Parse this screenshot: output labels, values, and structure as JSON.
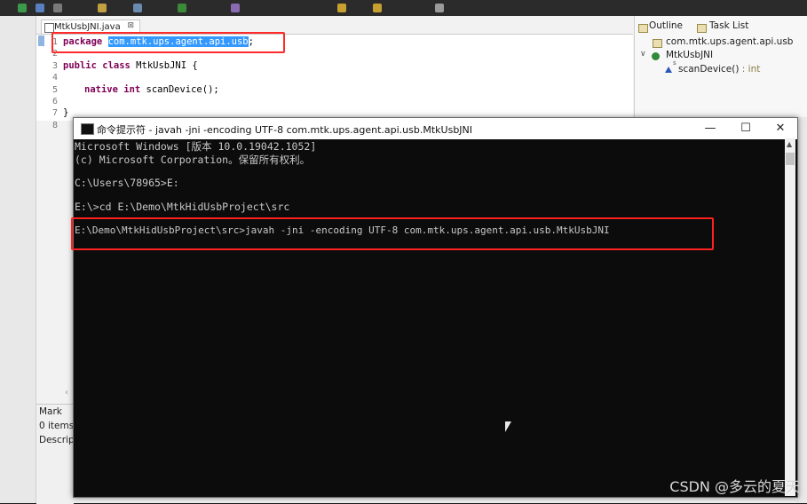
{
  "editor": {
    "tab_label": "MtkUsbJNI.java",
    "tab_close": "⊠",
    "lines": [
      {
        "n": "1",
        "kw": "package",
        "rest": " ",
        "sel": "com.mtk.ups.agent.api.usb",
        "tail": ";"
      },
      {
        "n": "2"
      },
      {
        "n": "3",
        "kw": "public class",
        "rest": " MtkUsbJNI {"
      },
      {
        "n": "4"
      },
      {
        "n": "5",
        "kw": "native int",
        "rest": " scanDevice();"
      },
      {
        "n": "6"
      },
      {
        "n": "7",
        "rest": "}"
      },
      {
        "n": "8"
      }
    ]
  },
  "outline": {
    "tab_outline": "Outline",
    "tab_tasklist": "Task List",
    "package": "com.mtk.ups.agent.api.usb",
    "class": "MtkUsbJNI",
    "method": "scanDevice()",
    "method_type": " : int",
    "method_mark": "s"
  },
  "bottom_panel": {
    "tab": "Mark",
    "items": "0 items",
    "header": "Descrip"
  },
  "cmd": {
    "title": "命令提示符 - javah  -jni -encoding UTF-8 com.mtk.ups.agent.api.usb.MtkUsbJNI",
    "minimize": "—",
    "maximize": "☐",
    "close": "✕",
    "lines": [
      "Microsoft Windows [版本 10.0.19042.1052]",
      "(c) Microsoft Corporation。保留所有权利。",
      "",
      "C:\\Users\\78965>E:",
      "",
      "E:\\>cd E:\\Demo\\MtkHidUsbProject\\src",
      "",
      "E:\\Demo\\MtkHidUsbProject\\src>javah -jni -encoding UTF-8 com.mtk.ups.agent.api.usb.MtkUsbJNI"
    ]
  },
  "watermark": "CSDN @多云的夏天"
}
